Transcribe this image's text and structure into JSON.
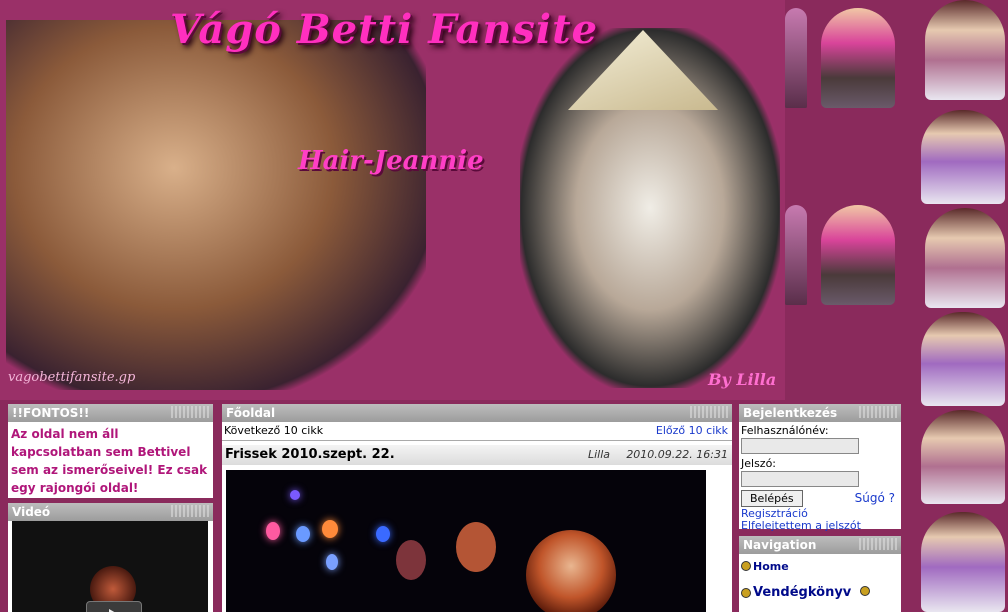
{
  "banner": {
    "title": "Vágó Betti Fansite",
    "subtitle": "Hair-Jeannie",
    "url_watermark": "vagobettifansite.gp",
    "signature": "By Lilla"
  },
  "left": {
    "important_header": "!!FONTOS!!",
    "important_text": "Az oldal nem áll kapcsolatban sem Bettivel sem az ismerőseivel! Ez csak egy rajongói oldal!",
    "video_header": "Videó"
  },
  "main": {
    "header": "Főoldal",
    "next_label": "Következő 10 cikk",
    "prev_label": "Előző 10 cikk",
    "news": {
      "title": "Frissek 2010.szept. 22.",
      "author": "Lilla",
      "date": "2010.09.22. 16:31"
    }
  },
  "login": {
    "header": "Bejelentkezés",
    "username_label": "Felhasználónév:",
    "password_label": "Jelszó:",
    "button_label": "Belépés",
    "help_label": "Súgó",
    "register_label": "Regisztráció",
    "forgot_label": "Elfelejtettem a jelszót"
  },
  "navigation": {
    "header": "Navigation",
    "items": [
      "Home",
      "Vendégkönyv"
    ]
  },
  "colors": {
    "background": "#8a2a5c",
    "title_pink": "#ff2fbf",
    "link_blue": "#1a3acc",
    "important_text": "#b0167a"
  }
}
